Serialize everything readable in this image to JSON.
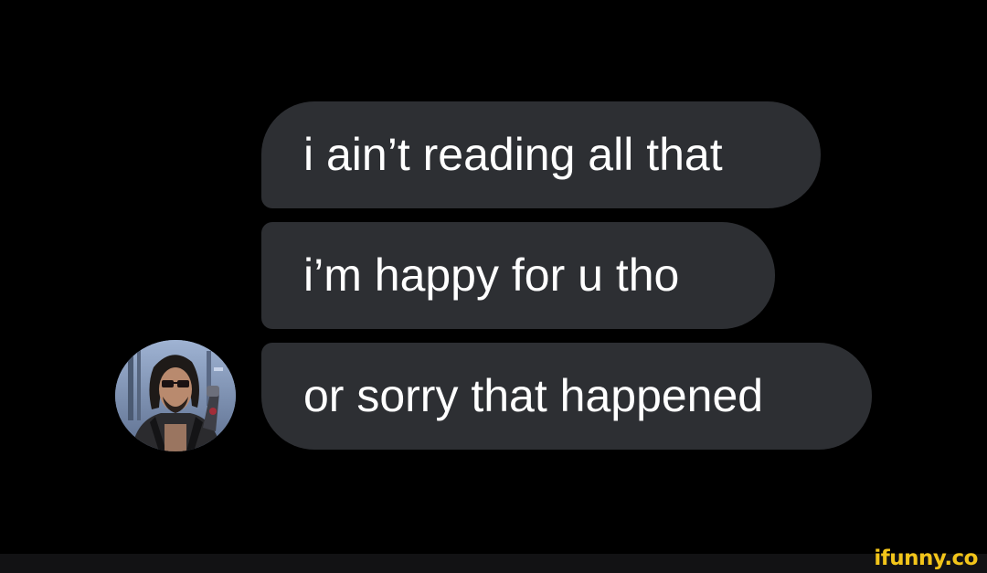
{
  "thread": {
    "messages": [
      {
        "text": "i ain’t reading all that"
      },
      {
        "text": "i’m happy for u tho"
      },
      {
        "text": "or sorry that happened"
      }
    ]
  },
  "colors": {
    "background": "#000000",
    "bubble": "#2d2f33",
    "message_text": "#ffffff",
    "watermark": "#f2c51a"
  },
  "watermark": {
    "text": "ifunny.co"
  }
}
